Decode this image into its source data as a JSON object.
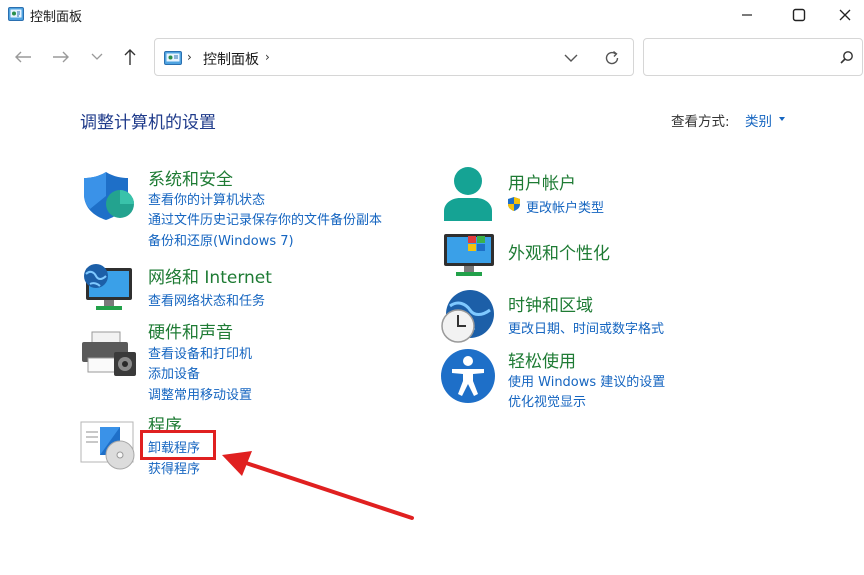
{
  "window": {
    "title": "控制面板"
  },
  "address": {
    "path": "控制面板"
  },
  "search": {
    "placeholder": ""
  },
  "page": {
    "title": "调整计算机的设置",
    "view_by_label": "查看方式:",
    "view_by_value": "类别"
  },
  "categories": {
    "system": {
      "title": "系统和安全",
      "links": [
        "查看你的计算机状态",
        "通过文件历史记录保存你的文件备份副本",
        "备份和还原(Windows 7)"
      ]
    },
    "network": {
      "title": "网络和 Internet",
      "links": [
        "查看网络状态和任务"
      ]
    },
    "hardware": {
      "title": "硬件和声音",
      "links": [
        "查看设备和打印机",
        "添加设备",
        "调整常用移动设置"
      ]
    },
    "programs": {
      "title": "程序",
      "links": [
        "卸载程序",
        "获得程序"
      ]
    },
    "user": {
      "title": "用户帐户",
      "links": [
        "更改帐户类型"
      ]
    },
    "appearance": {
      "title": "外观和个性化",
      "links": []
    },
    "clock": {
      "title": "时钟和区域",
      "links": [
        "更改日期、时间或数字格式"
      ]
    },
    "ease": {
      "title": "轻松使用",
      "links": [
        "使用 Windows 建议的设置",
        "优化视觉显示"
      ]
    }
  },
  "colors": {
    "link": "#1565c0",
    "category_title": "#1e7b34",
    "page_title": "#1e3a8a",
    "annotation": "#e02020"
  }
}
